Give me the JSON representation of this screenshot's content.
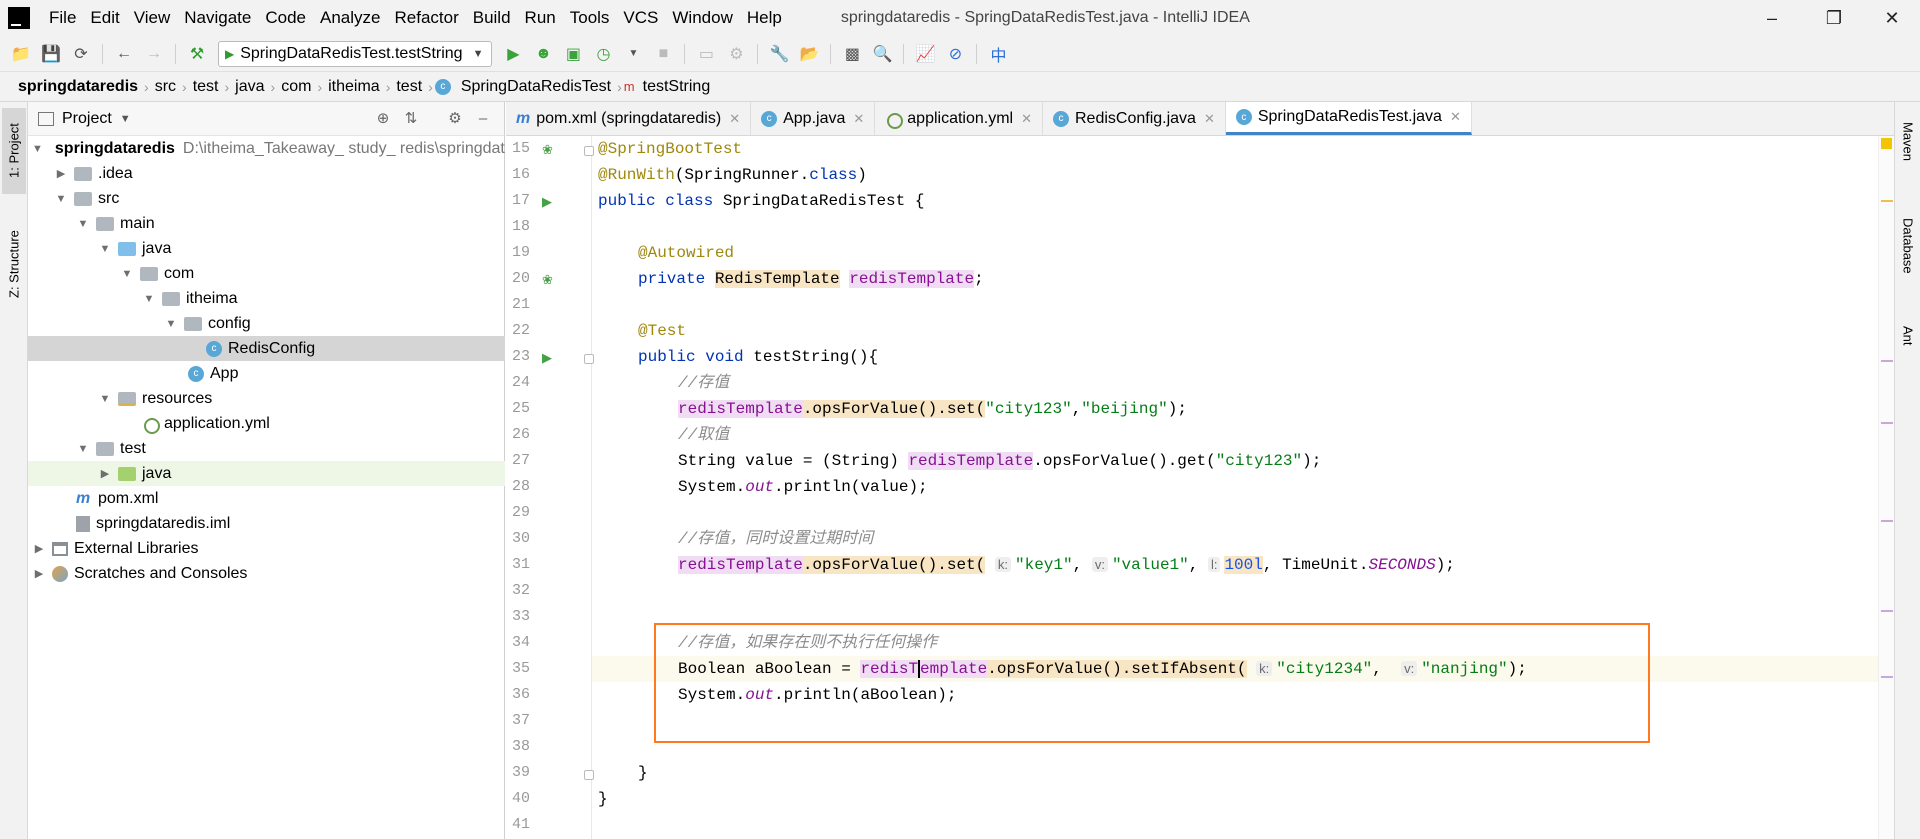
{
  "titlebar": {
    "menus": [
      "File",
      "Edit",
      "View",
      "Navigate",
      "Code",
      "Analyze",
      "Refactor",
      "Build",
      "Run",
      "Tools",
      "VCS",
      "Window",
      "Help"
    ],
    "title": "springdataredis - SpringDataRedisTest.java - IntelliJ IDEA"
  },
  "toolbar": {
    "run_config": "SpringDataRedisTest.testString"
  },
  "breadcrumbs": [
    "springdataredis",
    "src",
    "test",
    "java",
    "com",
    "itheima",
    "test",
    "SpringDataRedisTest",
    "testString"
  ],
  "side_tabs": {
    "project": "1: Project",
    "structure": "Z: Structure",
    "maven": "Maven",
    "database": "Database",
    "ant": "Ant"
  },
  "project_panel": {
    "title": "Project",
    "tree": [
      {
        "label": "springdataredis",
        "extra": "D:\\itheima_Takeaway_ study_ redis\\springdataredis"
      },
      {
        "label": ".idea"
      },
      {
        "label": "src"
      },
      {
        "label": "main"
      },
      {
        "label": "java"
      },
      {
        "label": "com"
      },
      {
        "label": "itheima"
      },
      {
        "label": "config"
      },
      {
        "label": "RedisConfig"
      },
      {
        "label": "App"
      },
      {
        "label": "resources"
      },
      {
        "label": "application.yml"
      },
      {
        "label": "test"
      },
      {
        "label": "java"
      },
      {
        "label": "pom.xml"
      },
      {
        "label": "springdataredis.iml"
      },
      {
        "label": "External Libraries"
      },
      {
        "label": "Scratches and Consoles"
      }
    ]
  },
  "editor_tabs": [
    {
      "label": "pom.xml (springdataredis)"
    },
    {
      "label": "App.java"
    },
    {
      "label": "application.yml"
    },
    {
      "label": "RedisConfig.java"
    },
    {
      "label": "SpringDataRedisTest.java"
    }
  ],
  "line_numbers": [
    "15",
    "16",
    "17",
    "18",
    "19",
    "20",
    "21",
    "22",
    "23",
    "24",
    "25",
    "26",
    "27",
    "28",
    "29",
    "30",
    "31",
    "32",
    "33",
    "34",
    "35",
    "36",
    "37",
    "38",
    "39",
    "40",
    "41"
  ],
  "code": {
    "l15": "@SpringBootTest",
    "l16_a": "@RunWith",
    "l16_b": "(SpringRunner.",
    "l16_c": "class",
    "l16_d": ")",
    "l17_a": "public class ",
    "l17_b": "SpringDataRedisTest {",
    "l19": "@Autowired",
    "l20_a": "private ",
    "l20_b": "RedisTemplate",
    "l20_c": "redisTemplate",
    "l20_d": ";",
    "l22": "@Test",
    "l23_a": "public void ",
    "l23_b": "testString(){",
    "l24": "//存值",
    "l25_a": "redisTemplate",
    "l25_b": ".opsForValue().set(",
    "l25_c": "\"city123\"",
    "l25_d": ",",
    "l25_e": "\"beijing\"",
    "l25_f": ");",
    "l26": "//取值",
    "l27_a": "String value = (String) ",
    "l27_b": "redisTemplate",
    "l27_c": ".opsForValue().get(",
    "l27_d": "\"city123\"",
    "l27_e": ");",
    "l28_a": "System.",
    "l28_b": "out",
    "l28_c": ".println(value);",
    "l30": "//存值，同时设置过期时间",
    "l31_a": "redisTemplate",
    "l31_b": ".opsForValue().set(",
    "l31_h1": "k:",
    "l31_c": "\"key1\"",
    "l31_h2": "v:",
    "l31_d": "\"value1\"",
    "l31_h3": "l:",
    "l31_e": "100l",
    "l31_f": ", TimeUnit.",
    "l31_g": "SECONDS",
    "l31_i": ");",
    "l34": "//存值，如果存在则不执行任何操作",
    "l35_a": "Boolean aBoolean = ",
    "l35_b1": "redisT",
    "l35_b2": "emplate",
    "l35_c": ".opsForValue().setIfAbsent(",
    "l35_h1": "k:",
    "l35_d": "\"city1234\"",
    "l35_h2": "v:",
    "l35_e": "\"nanjing\"",
    "l35_f": ");",
    "l36_a": "System.",
    "l36_b": "out",
    "l36_c": ".println(aBoolean);",
    "l39": "}",
    "l40": "}"
  },
  "colors": {
    "keyword": "#0033b3",
    "annotation": "#9e880d",
    "string": "#067d17",
    "field": "#871094",
    "comment": "#8c8c8c",
    "highlight_box": "#ff7a1f"
  }
}
